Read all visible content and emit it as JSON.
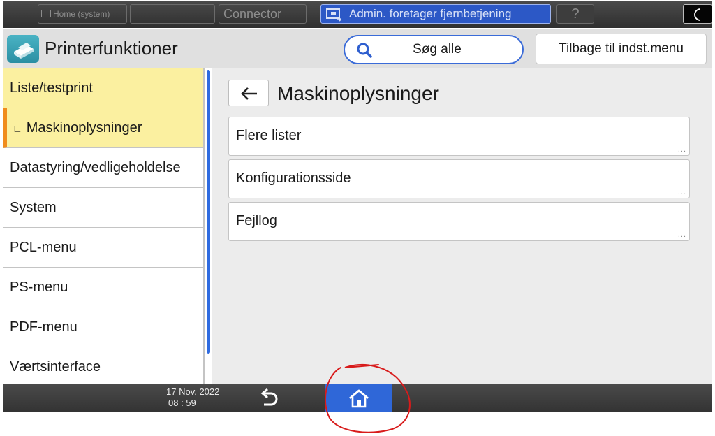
{
  "topbar": {
    "home_label": "Home (system)",
    "connector_label": "Connector",
    "admin_label": "Admin. foretager fjernbetjening",
    "help_label": "?",
    "icons": {
      "home": "keyboard-icon",
      "admin": "remote-screen-icon",
      "mode": "moon-icon"
    }
  },
  "header": {
    "title": "Printerfunktioner",
    "search_label": "Søg alle",
    "back_to_menu_label": "Tilbage til indst.menu"
  },
  "sidebar": {
    "items": [
      {
        "label": "Liste/testprint",
        "state": "selected"
      },
      {
        "label": "Maskinoplysninger",
        "prefix": "∟",
        "state": "selected-sub"
      },
      {
        "label": "Datastyring/vedligeholdelse"
      },
      {
        "label": "System"
      },
      {
        "label": "PCL-menu"
      },
      {
        "label": "PS-menu"
      },
      {
        "label": "PDF-menu"
      },
      {
        "label": "Værtsinterface"
      }
    ]
  },
  "main": {
    "title": "Maskinoplysninger",
    "items": [
      {
        "label": "Flere lister",
        "more": "..."
      },
      {
        "label": "Konfigurationsside",
        "more": "..."
      },
      {
        "label": "Fejllog",
        "more": "..."
      }
    ]
  },
  "bottombar": {
    "date": "17 Nov. 2022",
    "time": "08 : 59"
  },
  "colors": {
    "accent_blue": "#2f67d8",
    "selected_bg": "#fbf0a0",
    "selected_marker": "#f08c1c",
    "annotation_red": "#d81b1b"
  }
}
